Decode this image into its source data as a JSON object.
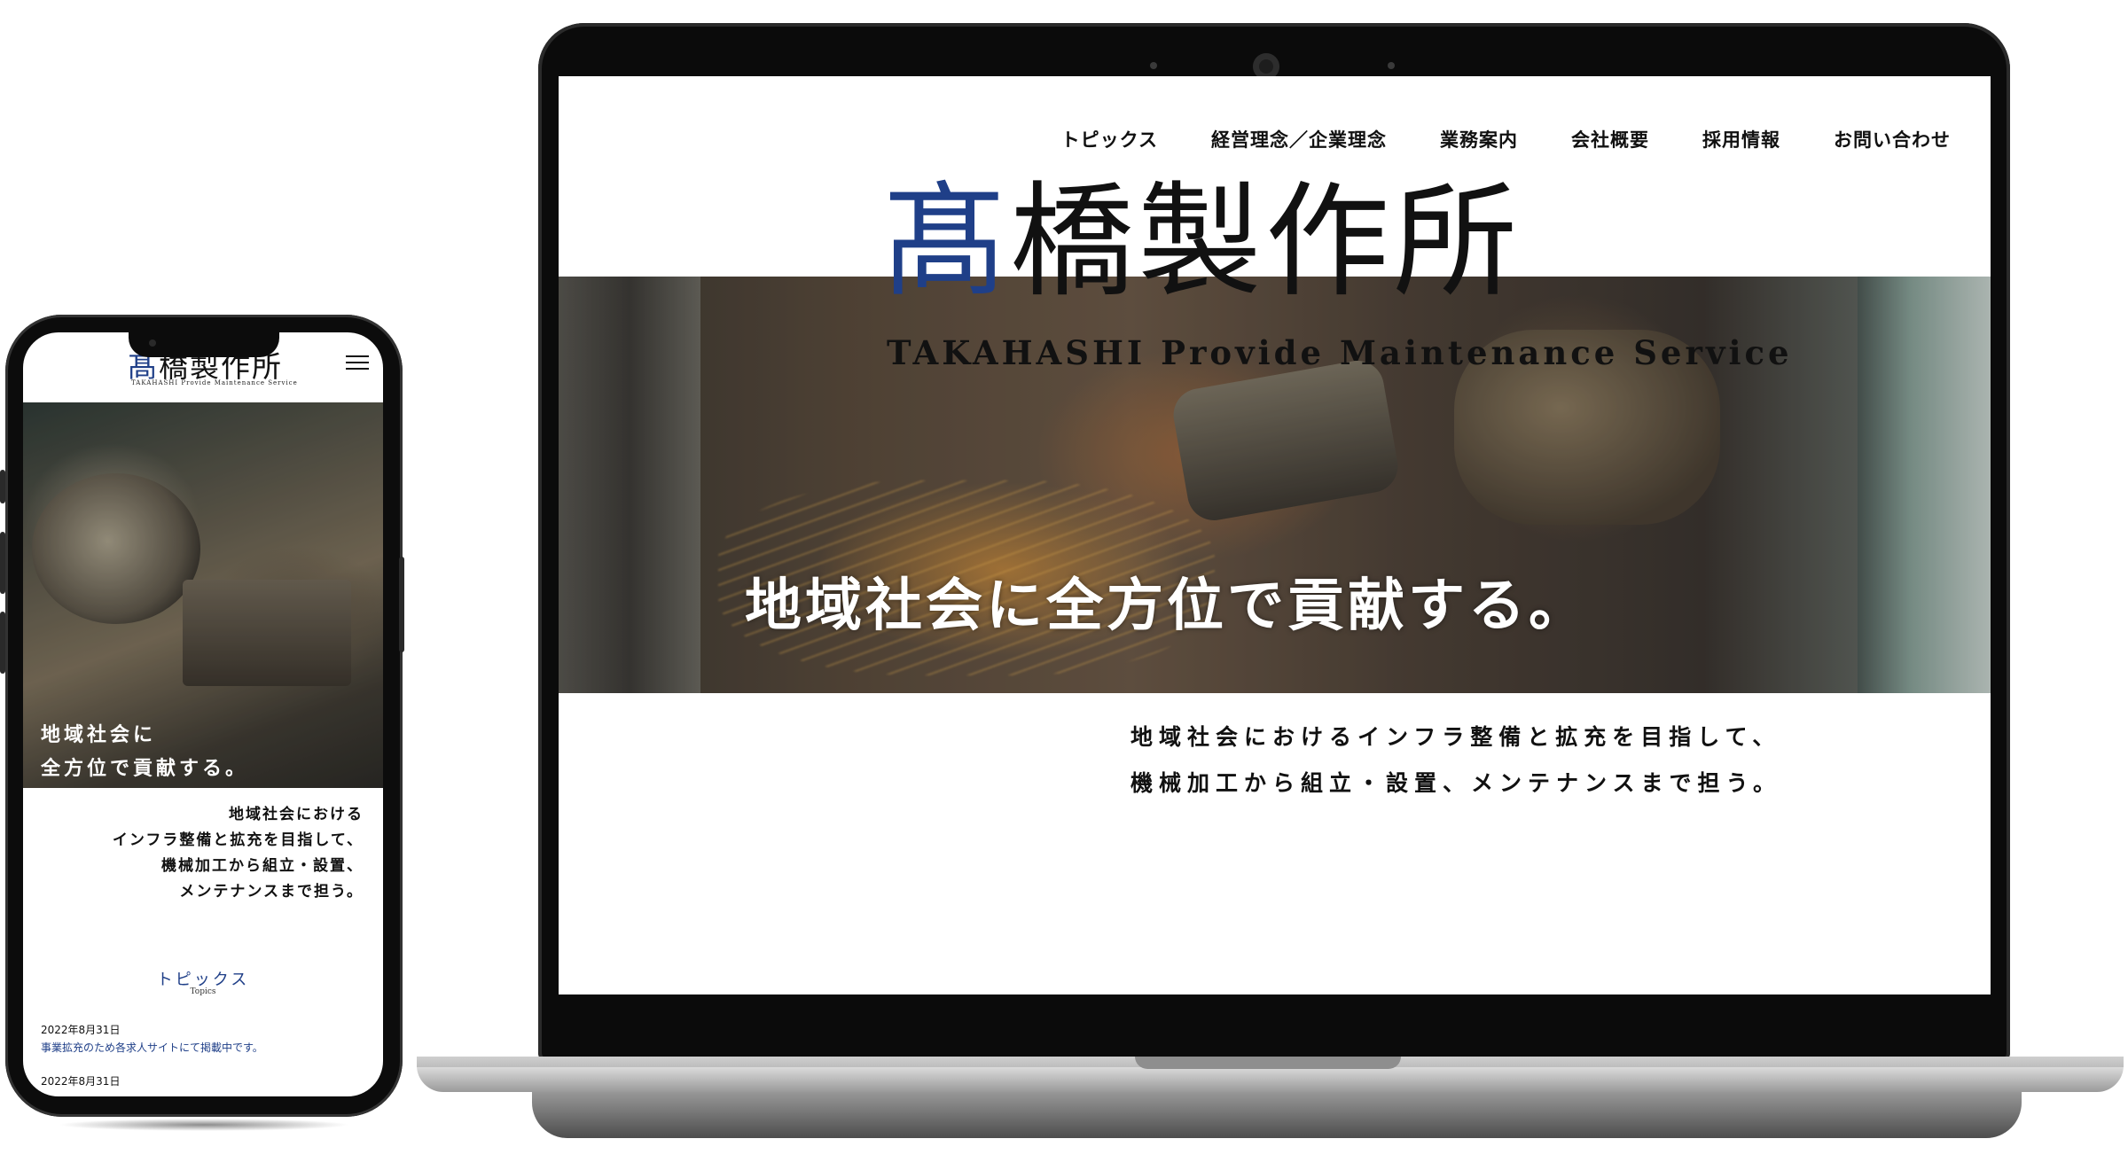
{
  "site": {
    "logo_first_char": "髙",
    "logo_rest": "橋製作所",
    "logo_en": "TAKAHASHI Provide Maintenance Service",
    "brand_color": "#1f3f88"
  },
  "desktop": {
    "nav": [
      "トピックス",
      "経営理念／企業理念",
      "業務案内",
      "会社概要",
      "採用情報",
      "お問い合わせ"
    ],
    "hero_catch": "地域社会に全方位で貢献する。",
    "desc_lines": [
      "地域社会におけるインフラ整備と拡充を目指して、",
      "機械加工から組立・設置、メンテナンスまで担う。"
    ]
  },
  "mobile": {
    "menu_icon": "hamburger-menu-icon",
    "hero_catch_lines": [
      "地域社会に",
      "全方位で貢献する。"
    ],
    "desc_lines": [
      "地域社会における",
      "インフラ整備と拡充を目指して、",
      "機械加工から組立・設置、",
      "メンテナンスまで担う。"
    ],
    "topics_title": "トピックス",
    "topics_sub": "Topics",
    "news": [
      {
        "date": "2022年8月31日",
        "text": "事業拡充のため各求人サイトにて掲載中です。"
      },
      {
        "date": "2022年8月31日",
        "text": ""
      }
    ]
  }
}
